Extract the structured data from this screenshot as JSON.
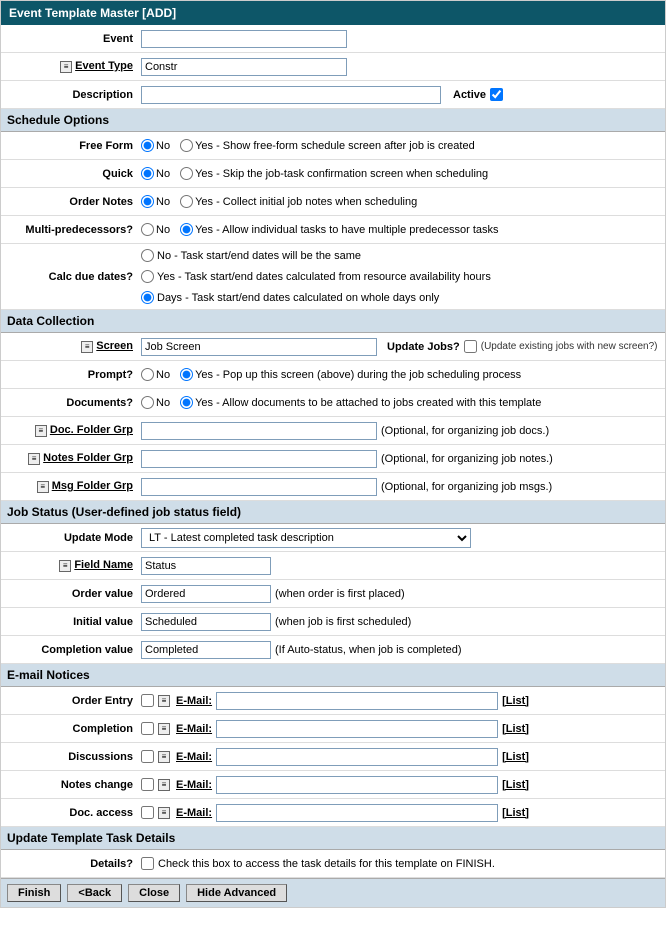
{
  "header": {
    "title": "Event Template Master   [ADD]"
  },
  "fields": {
    "event": {
      "label": "Event",
      "value": ""
    },
    "eventType": {
      "label": "Event Type",
      "value": "Constr"
    },
    "description": {
      "label": "Description",
      "value": "",
      "activeLabel": "Active",
      "activeChecked": true
    }
  },
  "sections": {
    "scheduleOptions": "Schedule Options",
    "dataCollection": "Data Collection",
    "jobStatus": "Job Status (User-defined job status field)",
    "emailNotices": "E-mail Notices",
    "updateTemplate": "Update Template Task Details"
  },
  "schedule": {
    "freeForm": {
      "label": "Free Form",
      "no": "No",
      "yes": "Yes - Show free-form schedule screen after job is created"
    },
    "quick": {
      "label": "Quick",
      "no": "No",
      "yes": "Yes - Skip the job-task confirmation screen when scheduling"
    },
    "orderNotes": {
      "label": "Order Notes",
      "no": "No",
      "yes": "Yes - Collect initial job notes when scheduling"
    },
    "multiPred": {
      "label": "Multi-predecessors?",
      "no": "No",
      "yes": "Yes - Allow individual tasks to have multiple predecessor tasks"
    },
    "calcDue": {
      "label": "Calc due dates?",
      "opt1": "No - Task start/end dates will be the same",
      "opt2": "Yes - Task start/end dates calculated from resource availability hours",
      "opt3": "Days - Task start/end dates calculated on whole days only"
    }
  },
  "dataCollection": {
    "screen": {
      "label": "Screen",
      "value": "Job Screen",
      "updateJobsLabel": "Update Jobs?",
      "hint": "(Update existing jobs with new screen?)"
    },
    "prompt": {
      "label": "Prompt?",
      "no": "No",
      "yes": "Yes - Pop up this screen (above) during the job scheduling process"
    },
    "documents": {
      "label": "Documents?",
      "no": "No",
      "yes": "Yes - Allow documents to be attached to jobs created with this template"
    },
    "docFolder": {
      "label": "Doc. Folder Grp",
      "value": "",
      "hint": "(Optional, for organizing job docs.)"
    },
    "notesFolder": {
      "label": "Notes Folder Grp",
      "value": "",
      "hint": "(Optional, for organizing job notes.)"
    },
    "msgFolder": {
      "label": "Msg Folder Grp",
      "value": "",
      "hint": "(Optional, for organizing job msgs.)"
    }
  },
  "jobStatus": {
    "updateMode": {
      "label": "Update Mode",
      "value": "LT - Latest completed task description"
    },
    "fieldName": {
      "label": "Field Name",
      "value": "Status"
    },
    "orderValue": {
      "label": "Order value",
      "value": "Ordered",
      "hint": "(when order is first placed)"
    },
    "initialValue": {
      "label": "Initial value",
      "value": "Scheduled",
      "hint": "(when job is first scheduled)"
    },
    "completionValue": {
      "label": "Completion value",
      "value": "Completed",
      "hint": "(If Auto-status, when job is completed)"
    }
  },
  "emailNotices": {
    "orderEntry": {
      "label": "Order Entry",
      "emailLabel": " E-Mail:",
      "listLabel": "[List]"
    },
    "completion": {
      "label": "Completion",
      "emailLabel": " E-Mail:",
      "listLabel": "[List]"
    },
    "discussions": {
      "label": "Discussions",
      "emailLabel": " E-Mail:",
      "listLabel": "[List]"
    },
    "notesChange": {
      "label": "Notes change",
      "emailLabel": " E-Mail:",
      "listLabel": "[List]"
    },
    "docAccess": {
      "label": "Doc. access",
      "emailLabel": " E-Mail:",
      "listLabel": "[List]"
    }
  },
  "updateTemplate": {
    "details": {
      "label": "Details?",
      "text": "Check this box to access the task details for this template on FINISH."
    }
  },
  "buttons": {
    "finish": "Finish",
    "back": "<Back",
    "close": "Close",
    "hideAdvanced": "Hide Advanced"
  }
}
